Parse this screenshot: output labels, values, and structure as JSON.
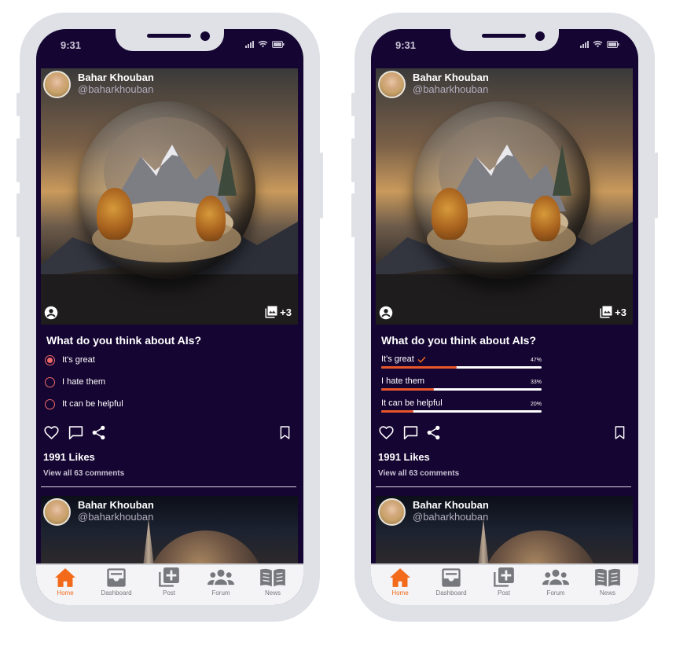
{
  "status_bar": {
    "time": "9:31"
  },
  "post": {
    "author_name": "Bahar Khouban",
    "author_handle": "@baharkhouban",
    "gallery_extra": "+3",
    "poll": {
      "question": "What do you think about AIs?",
      "options": [
        {
          "label": "It's great",
          "selected": true,
          "percent": "47%",
          "value": 0.47
        },
        {
          "label": "I hate them",
          "selected": false,
          "percent": "33%",
          "value": 0.33
        },
        {
          "label": "It can be helpful",
          "selected": false,
          "percent": "20%",
          "value": 0.2
        }
      ]
    },
    "likes": "1991 Likes",
    "comments_link": "View all 63 comments"
  },
  "next_post": {
    "author_name": "Bahar Khouban",
    "author_handle": "@baharkhouban"
  },
  "tabbar": {
    "tabs": [
      {
        "label": "Home",
        "icon": "home-icon",
        "active": true
      },
      {
        "label": "Dashboard",
        "icon": "inbox-icon",
        "active": false
      },
      {
        "label": "Post",
        "icon": "add-photo-icon",
        "active": false
      },
      {
        "label": "Forum",
        "icon": "group-icon",
        "active": false
      },
      {
        "label": "News",
        "icon": "book-icon",
        "active": false
      }
    ]
  },
  "colors": {
    "background": "#150532",
    "accent": "#f26a1a",
    "radio": "#f06a6a",
    "bar_fill": "#e8562a"
  }
}
